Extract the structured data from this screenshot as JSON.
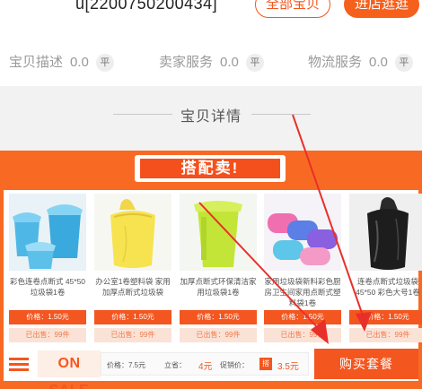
{
  "shop": {
    "id_text": "u[2200750200434]",
    "all_items_label": "全部宝贝",
    "enter_shop_label": "进店逛逛"
  },
  "ratings": [
    {
      "label": "宝贝描述",
      "score": "0.0",
      "level": "平"
    },
    {
      "label": "卖家服务",
      "score": "0.0",
      "level": "平"
    },
    {
      "label": "物流服务",
      "score": "0.0",
      "level": "平"
    }
  ],
  "details": {
    "title": "宝贝详情"
  },
  "combo": {
    "title": "搭配卖!",
    "products": [
      {
        "name": "彩色连卷点断式 45*50 垃圾袋1卷",
        "price": "价格：1.50元",
        "sold": "已出售：99件",
        "icon": "blue-bins-with-bags-image"
      },
      {
        "name": "办公室1卷塑料袋 家用加厚点断式垃圾袋",
        "price": "价格：1.50元",
        "sold": "已出售：99件",
        "icon": "yellow-trash-bag-image"
      },
      {
        "name": "加厚点断式环保清洁家用垃圾袋1卷",
        "price": "价格：1.50元",
        "sold": "已出售：99件",
        "icon": "green-trash-can-image"
      },
      {
        "name": "家用垃圾袋新料彩色厨房卫生间家用点断式塑料袋1卷",
        "price": "价格：1.50元",
        "sold": "已出售：99件",
        "icon": "colorful-bag-rolls-image"
      },
      {
        "name": "连卷点断式垃圾袋 45*50 彩色大号1卷",
        "price": "价格：1.50元",
        "sold": "已出售：99件",
        "icon": "black-trash-bag-image"
      }
    ]
  },
  "bottom": {
    "onsale_label": "ON SALE",
    "price_label": "价格：7.5元",
    "save_label": "立省：",
    "save_value": "4元",
    "promo_label": "促销价：",
    "promo_tag": "搭",
    "promo_value": "3.5元",
    "buy_label": "购买套餐"
  },
  "colors": {
    "accent": "#f4561f",
    "panel": "#f86a24",
    "arrow": "#e8302a"
  }
}
